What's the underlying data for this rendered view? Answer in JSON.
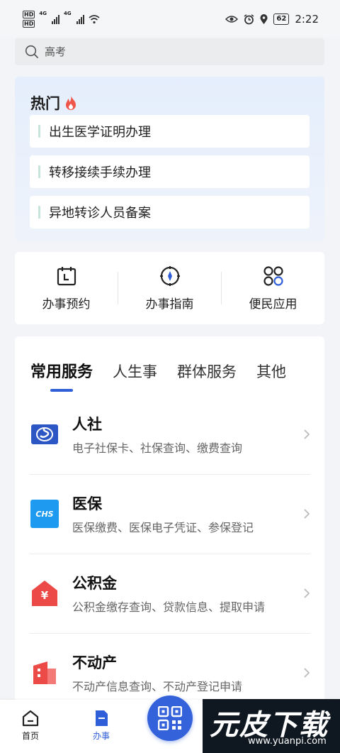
{
  "status_bar": {
    "hd1": "HD",
    "hd2": "HD",
    "net1": "4G",
    "net2": "4G",
    "battery": "62",
    "time": "2:22"
  },
  "search": {
    "placeholder": "高考"
  },
  "hot": {
    "title": "热门",
    "items": [
      {
        "label": "出生医学证明办理"
      },
      {
        "label": "转移接续手续办理"
      },
      {
        "label": "异地转诊人员备案"
      }
    ]
  },
  "quick": {
    "items": [
      {
        "label": "办事预约",
        "icon": "calendar-icon"
      },
      {
        "label": "办事指南",
        "icon": "compass-icon"
      },
      {
        "label": "便民应用",
        "icon": "apps-icon"
      }
    ]
  },
  "services": {
    "tabs": [
      {
        "label": "常用服务",
        "active": true
      },
      {
        "label": "人生事"
      },
      {
        "label": "群体服务"
      },
      {
        "label": "其他"
      }
    ],
    "rows": [
      {
        "name": "人社",
        "desc": "电子社保卡、社保查询、缴费查询",
        "icon": "si-logo-icon"
      },
      {
        "name": "医保",
        "desc": "医保缴费、医保电子凭证、参保登记",
        "icon": "chs-logo-icon",
        "logo_text": "CHS"
      },
      {
        "name": "公积金",
        "desc": "公积金缴存查询、贷款信息、提取申请",
        "icon": "housing-fund-icon",
        "logo_text": "¥"
      },
      {
        "name": "不动产",
        "desc": "不动产信息查询、不动产登记申请",
        "icon": "building-icon"
      }
    ]
  },
  "bottom_nav": {
    "home": "首页",
    "affairs": "办事"
  },
  "watermark": {
    "main": "元皮下载",
    "url": "www.yuanpi.com"
  },
  "colors": {
    "accent": "#2f5fd8",
    "hot_bg": "#e5eefc",
    "flame": "#f0554a"
  }
}
